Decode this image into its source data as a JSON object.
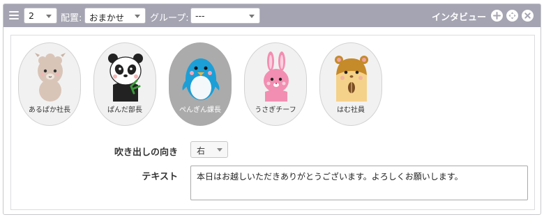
{
  "toolbar": {
    "count_value": "2",
    "layout_label": "配置:",
    "layout_value": "おまかせ",
    "group_label": "グループ:",
    "group_value": "---",
    "title": "インタビュー",
    "icons": [
      "menu-icon",
      "add-icon",
      "move-icon",
      "close-icon"
    ]
  },
  "characters": [
    {
      "name": "あるぱか社長",
      "icon": "alpaca-icon",
      "selected": false
    },
    {
      "name": "ぱんだ部長",
      "icon": "panda-icon",
      "selected": false
    },
    {
      "name": "ぺんぎん課長",
      "icon": "penguin-icon",
      "selected": true
    },
    {
      "name": "うさぎチーフ",
      "icon": "rabbit-icon",
      "selected": false
    },
    {
      "name": "はむ社員",
      "icon": "hamster-icon",
      "selected": false
    }
  ],
  "form": {
    "direction_label": "吹き出しの向き",
    "direction_value": "右",
    "text_label": "テキスト",
    "text_value": "本日はお越しいただきありがとうございます。よろしくお願いします。"
  },
  "colors": {
    "toolbar_bg": "#a5a4b2",
    "selected_char_bg": "#ababab",
    "char_bg": "#f1f1f1"
  }
}
